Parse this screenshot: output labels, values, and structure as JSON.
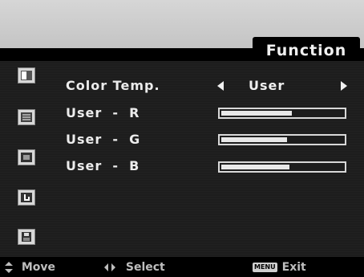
{
  "header": {
    "title": "Function"
  },
  "sidebar": {
    "icons": [
      "picture-icon",
      "keystone-icon",
      "image-icon",
      "setup-hand-icon",
      "save-icon"
    ]
  },
  "settings": {
    "color_temp": {
      "label": "Color Temp.",
      "value": "User"
    },
    "user_r": {
      "label": "User  -  R",
      "level": 0.58
    },
    "user_g": {
      "label": "User  -  G",
      "level": 0.54
    },
    "user_b": {
      "label": "User  -  B",
      "level": 0.56
    }
  },
  "footer": {
    "move_label": "Move",
    "select_label": "Select",
    "menu_key": "MENU",
    "exit_label": "Exit"
  }
}
